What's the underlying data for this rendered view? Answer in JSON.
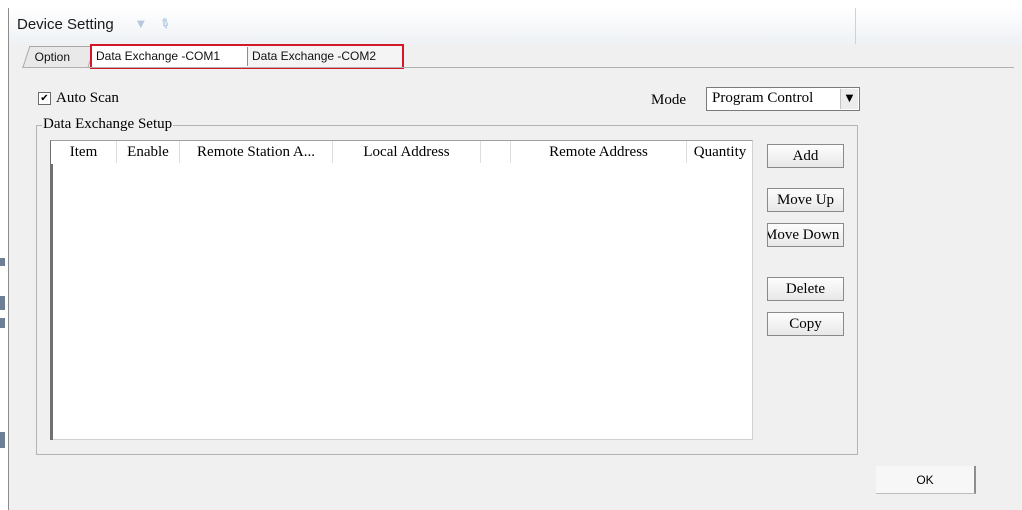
{
  "window": {
    "title": "Device Setting"
  },
  "tabs": [
    {
      "label": "Option",
      "active": false
    },
    {
      "label": "Data Exchange -COM1",
      "active": true
    },
    {
      "label": "Data Exchange -COM2",
      "active": false
    }
  ],
  "auto_scan": {
    "label": "Auto Scan",
    "checked": true,
    "check_glyph": "✔"
  },
  "mode": {
    "label": "Mode",
    "selected": "Program Control"
  },
  "group": {
    "title": "Data Exchange Setup"
  },
  "table": {
    "columns": [
      "Item",
      "Enable",
      "Remote Station A...",
      "Local Address",
      "",
      "Remote Address",
      "Quantity"
    ],
    "rows": []
  },
  "buttons": {
    "add": "Add",
    "move_up": "Move Up",
    "move_down": "Move Down",
    "delete": "Delete",
    "copy": "Copy",
    "ok": "OK"
  },
  "colors": {
    "highlight_border": "#d3182a",
    "dialog_background": "#f0f0f0"
  },
  "icons": {
    "title_dropdown": "chevron-down-icon",
    "title_pin": "pin-icon",
    "mode_dropdown": "dropdown-arrow-icon"
  }
}
